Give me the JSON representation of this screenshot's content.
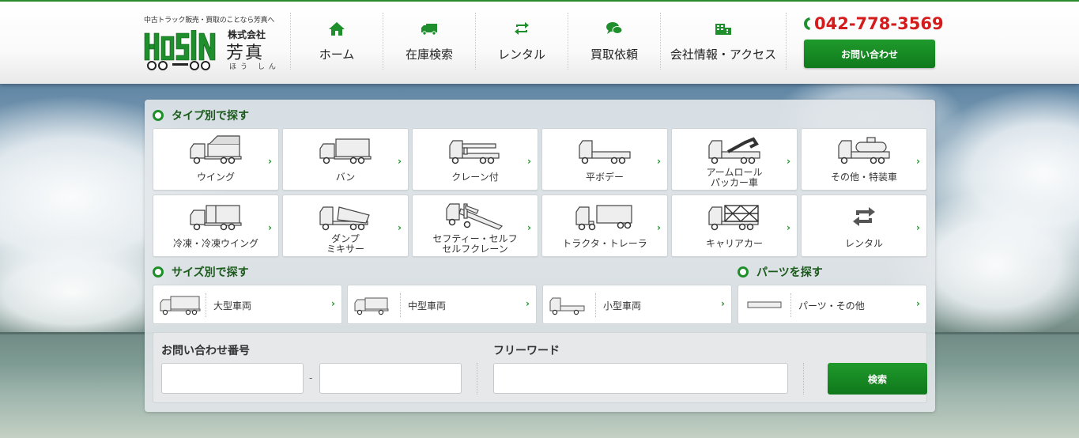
{
  "header": {
    "tagline": "中古トラック販売・買取のことなら芳真へ",
    "company_prefix": "株式会社",
    "company_name": "芳真",
    "company_kana": "ほう しん",
    "logo_text": "HOSIN",
    "phone": "042-778-3569",
    "contact_label": "お問い合わせ",
    "brand_color": "#1f8f29",
    "phone_color": "#d41c1c"
  },
  "nav": [
    {
      "label": "ホーム",
      "icon": "home-icon"
    },
    {
      "label": "在庫検索",
      "icon": "truck-icon"
    },
    {
      "label": "レンタル",
      "icon": "rental-cycle-icon"
    },
    {
      "label": "買取依頼",
      "icon": "chat-bubble-icon"
    },
    {
      "label": "会社情報・アクセス",
      "icon": "building-icon"
    }
  ],
  "search": {
    "type_title": "タイプ別で探す",
    "types": [
      {
        "label": "ウイング",
        "icon": "wing-truck-icon"
      },
      {
        "label": "バン",
        "icon": "van-truck-icon"
      },
      {
        "label": "クレーン付",
        "icon": "crane-truck-icon"
      },
      {
        "label": "平ボデー",
        "icon": "flatbed-truck-icon"
      },
      {
        "label": "アームロール",
        "label2": "パッカー車",
        "icon": "armroll-truck-icon"
      },
      {
        "label": "その他・特装車",
        "icon": "special-truck-icon"
      },
      {
        "label": "冷凍・冷凍ウイング",
        "icon": "refrigerated-truck-icon"
      },
      {
        "label": "ダンプ",
        "label2": "ミキサー",
        "icon": "dump-truck-icon"
      },
      {
        "label": "セフティー・セルフ",
        "label2": "セルフクレーン",
        "icon": "safety-loader-icon"
      },
      {
        "label": "トラクタ・トレーラ",
        "icon": "tractor-trailer-icon"
      },
      {
        "label": "キャリアカー",
        "icon": "car-carrier-icon"
      },
      {
        "label": "レンタル",
        "icon": "rental-cycle-icon"
      }
    ],
    "size_title": "サイズ別で探す",
    "sizes": [
      {
        "label": "大型車両",
        "icon": "large-truck-icon"
      },
      {
        "label": "中型車両",
        "icon": "medium-truck-icon"
      },
      {
        "label": "小型車両",
        "icon": "small-truck-icon"
      }
    ],
    "parts_title": "パーツを探す",
    "parts": {
      "label": "パーツ・その他",
      "icon": "parts-icon"
    },
    "inquiry_label": "お問い合わせ番号",
    "inquiry_value_1": "",
    "inquiry_value_2": "",
    "inquiry_separator": "-",
    "freeword_label": "フリーワード",
    "freeword_value": "",
    "search_label": "検索"
  }
}
